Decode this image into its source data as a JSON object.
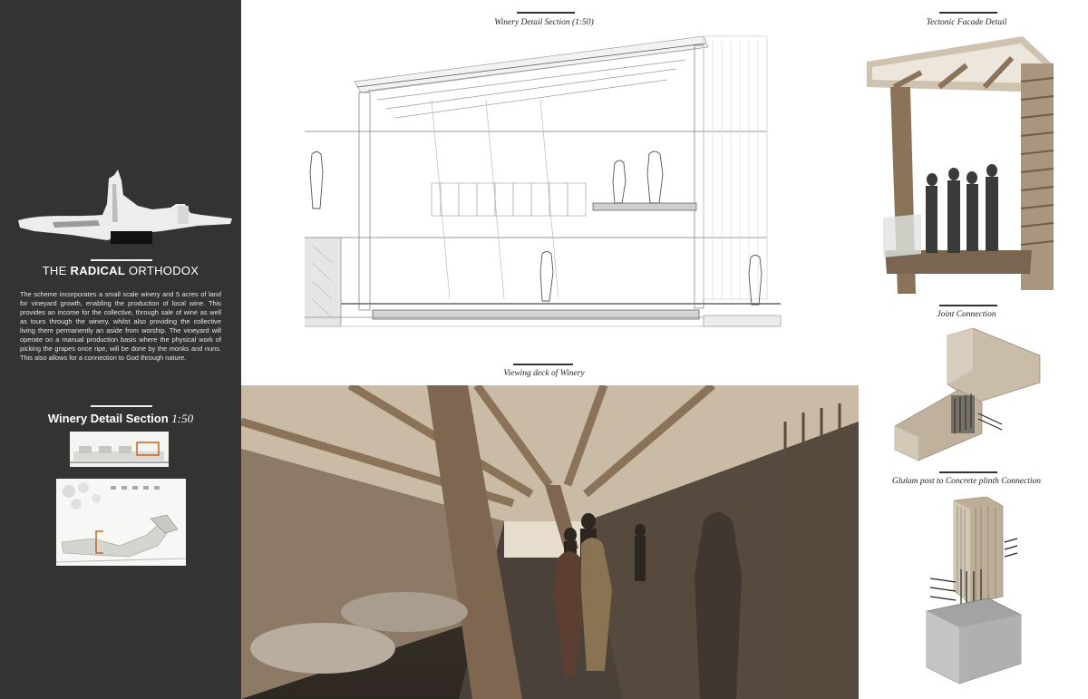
{
  "sidebar": {
    "title_pre": "THE ",
    "title_bold": "RADICAL",
    "title_post": " ORTHODOX",
    "description": "The scheme incorporates a small scale winery and 5 acres of land for vineyard growth, enabling the production of local wine. This provides an income for the collective, through sale of wine as well as tours through the winery, whilst also providing the collective living there permanently an aside from worship. The vineyard will operate on a manual production basis where the physical work of picking the grapes once ripe, will be done by the monks and nuns. This also allows for a connection to God through nature.",
    "section_title": "Winery Detail Section ",
    "section_scale": "1:50"
  },
  "captions": {
    "section": "Winery Detail Section (1:50)",
    "viewing_deck": "Viewing deck of Winery",
    "facade": "Tectonic Facade Detail",
    "joint": "Joint Connection",
    "plinth": "Glulam post to Concrete plinth Connection"
  },
  "colors": {
    "sidebar_bg": "#333331",
    "accent_orange": "#c8641e",
    "render_dark": "#2e2823",
    "timber": "#8a7358"
  }
}
